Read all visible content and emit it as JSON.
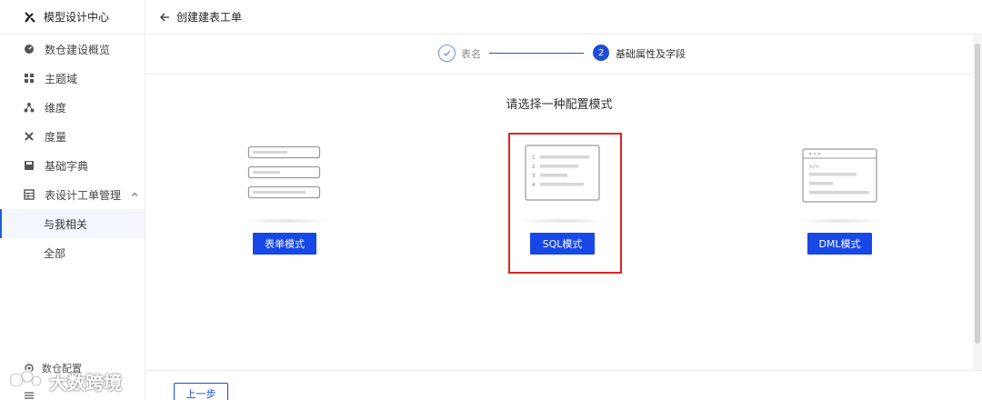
{
  "sidebar": {
    "brand": "模型设计中心",
    "items": [
      {
        "label": "数仓建设概览",
        "icon": "gauge-icon"
      },
      {
        "label": "主题域",
        "icon": "grid-icon"
      },
      {
        "label": "维度",
        "icon": "hierarchy-icon"
      },
      {
        "label": "度量",
        "icon": "tools-icon"
      },
      {
        "label": "基础字典",
        "icon": "save-icon"
      },
      {
        "label": "表设计工单管理",
        "icon": "table-icon",
        "expanded": true
      }
    ],
    "sub_items": [
      {
        "label": "与我相关",
        "active": true
      },
      {
        "label": "全部",
        "active": false
      }
    ],
    "bottom_item": "数仓配置"
  },
  "header": {
    "title": "创建建表工单"
  },
  "steps": [
    {
      "index": "1",
      "label": "表名",
      "status": "done"
    },
    {
      "index": "2",
      "label": "基础属性及字段",
      "status": "active"
    }
  ],
  "content": {
    "prompt": "请选择一种配置模式",
    "modes": [
      {
        "label": "表单模式",
        "selected": false
      },
      {
        "label": "SQL模式",
        "selected": true
      },
      {
        "label": "DML模式",
        "selected": false
      }
    ],
    "sql_line_numbers": [
      "1",
      "2",
      "3",
      "4"
    ],
    "code_tag": "</>"
  },
  "footer": {
    "prev_label": "上一步"
  },
  "watermark": {
    "text": "大数跨境"
  },
  "colors": {
    "primary": "#1747e6",
    "highlight": "#e02424",
    "active_bg": "#f3f6fd"
  }
}
